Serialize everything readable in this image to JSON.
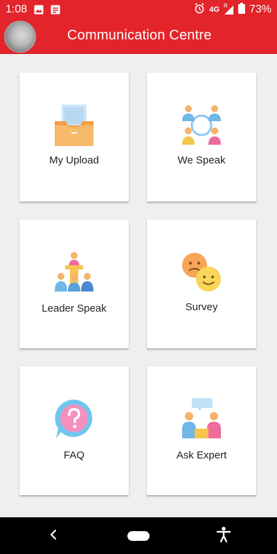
{
  "status_bar": {
    "time": "1:08",
    "network": "4G",
    "signal_tag": "R",
    "battery": "73%"
  },
  "app_bar": {
    "title": "Communication Centre"
  },
  "tiles": [
    {
      "label": "My Upload",
      "icon": "tray-upload-icon"
    },
    {
      "label": "We Speak",
      "icon": "group-discussion-icon"
    },
    {
      "label": "Leader Speak",
      "icon": "leader-podium-icon"
    },
    {
      "label": "Survey",
      "icon": "emoji-faces-icon"
    },
    {
      "label": "FAQ",
      "icon": "question-bubble-icon"
    },
    {
      "label": "Ask Expert",
      "icon": "consultation-icon"
    }
  ],
  "colors": {
    "primary": "#e3242b",
    "background": "#efefef",
    "card": "#ffffff",
    "navbar": "#000000"
  }
}
